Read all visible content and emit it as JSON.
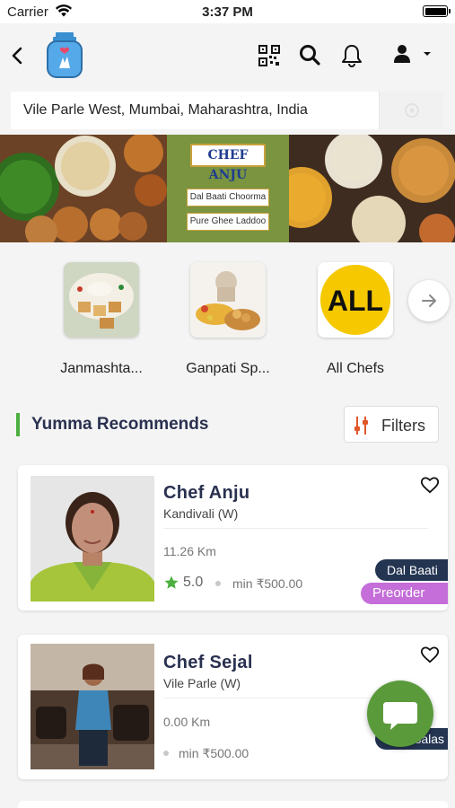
{
  "status_bar": {
    "carrier": "Carrier",
    "time": "3:37 PM"
  },
  "header": {
    "icons": [
      "chevron-left-icon",
      "app-logo",
      "qr-code-icon",
      "search-icon",
      "bell-icon",
      "user-icon",
      "caret-down-icon"
    ]
  },
  "location": {
    "value": "Vile Parle West, Mumbai, Maharashtra, India"
  },
  "banner": {
    "chef_label": "CHEF ANJU",
    "dishes": [
      "Dal Baati Choorma",
      "Pure Ghee Laddoo"
    ]
  },
  "categories": {
    "items": [
      {
        "label": "Janmashta..."
      },
      {
        "label": "Ganpati Sp..."
      },
      {
        "label": "All Chefs",
        "badge": "ALL"
      }
    ],
    "next_icon": "arrow-right-icon"
  },
  "recommend": {
    "title": "Yumma Recommends",
    "filter_label": "Filters",
    "filter_icon": "sliders-icon"
  },
  "chefs": [
    {
      "name": "Chef Anju",
      "area": "Kandivali (W)",
      "distance": "11.26 Km",
      "rating": "5.0",
      "min_order": "min ₹500.00",
      "tags": [
        "Dal Baati",
        "Preorder"
      ]
    },
    {
      "name": "Chef Sejal",
      "area": "Vile Parle (W)",
      "distance": "0.00 Km",
      "min_order": "min ₹500.00",
      "tags": [
        "salas"
      ]
    }
  ],
  "chat_fab_icon": "chat-icon",
  "colors": {
    "brand_navy": "#2a3150",
    "accent_green": "#4caf3f",
    "fab_green": "#5a9a3b",
    "tag_navy": "#243552",
    "tag_purple": "#c56ed9",
    "all_chefs_yellow": "#f5c800"
  }
}
